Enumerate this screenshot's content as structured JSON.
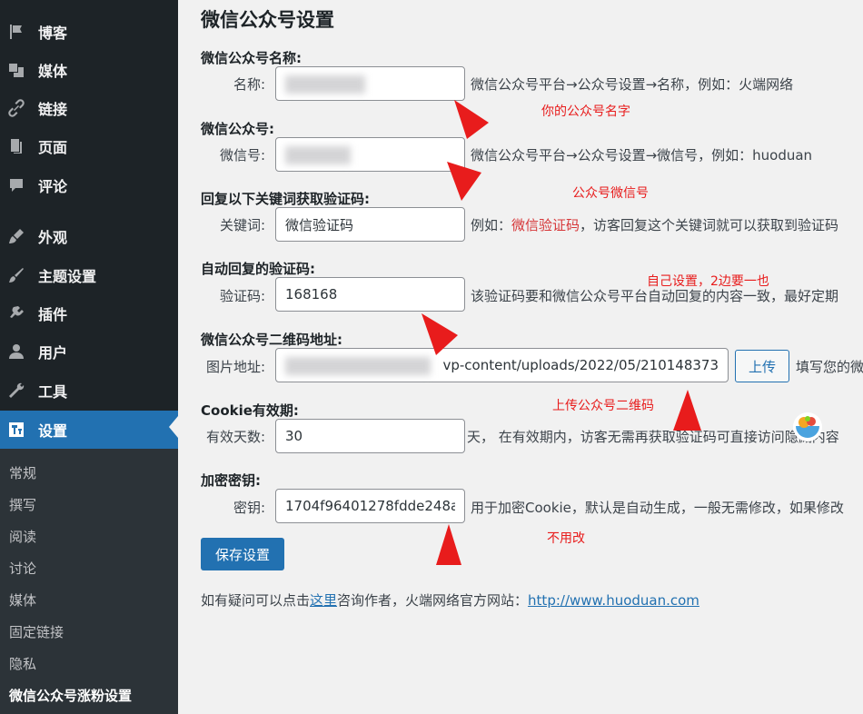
{
  "sidebar": {
    "items": [
      {
        "label": "博客",
        "icon": "flag-icon"
      },
      {
        "label": "媒体",
        "icon": "media-icon"
      },
      {
        "label": "链接",
        "icon": "link-icon"
      },
      {
        "label": "页面",
        "icon": "page-icon"
      },
      {
        "label": "评论",
        "icon": "comment-icon"
      },
      {
        "label": "外观",
        "icon": "paintbrush-icon"
      },
      {
        "label": "主题设置",
        "icon": "brush-icon"
      },
      {
        "label": "插件",
        "icon": "plugin-icon"
      },
      {
        "label": "用户",
        "icon": "user-icon"
      },
      {
        "label": "工具",
        "icon": "wrench-icon"
      },
      {
        "label": "设置",
        "icon": "settings-icon"
      }
    ],
    "submenu": [
      "常规",
      "撰写",
      "阅读",
      "讨论",
      "媒体",
      "固定链接",
      "隐私",
      "微信公众号涨粉设置"
    ]
  },
  "page": {
    "title": "微信公众号设置",
    "sections": [
      {
        "heading": "微信公众号名称:",
        "label": "名称:",
        "value": "",
        "desc": "微信公众号平台→公众号设置→名称，例如：火端网络"
      },
      {
        "heading": "微信公众号:",
        "label": "微信号:",
        "value": "",
        "desc": "微信公众号平台→公众号设置→微信号，例如：huoduan"
      },
      {
        "heading": "回复以下关键词获取验证码:",
        "label": "关键词:",
        "value": "微信验证码",
        "desc_prefix": "例如：",
        "desc_highlight": "微信验证码",
        "desc_suffix": "，访客回复这个关键词就可以获取到验证码"
      },
      {
        "heading": "自动回复的验证码:",
        "label": "验证码:",
        "value": "168168",
        "desc": "该验证码要和微信公众号平台自动回复的内容一致，最好定期"
      },
      {
        "heading": "微信公众号二维码地址:",
        "label": "图片地址:",
        "value": "vp-content/uploads/2022/05/210148373",
        "upload_label": "上传",
        "desc": "填写您的微"
      },
      {
        "heading": "Cookie有效期:",
        "label": "有效天数:",
        "value": "30",
        "desc": "天，  在有效期内，访客无需再获取验证码可直接访问隐藏内容"
      },
      {
        "heading": "加密密钥:",
        "label": "密钥:",
        "value": "1704f96401278fdde248a",
        "desc": "用于加密Cookie，默认是自动生成，一般无需修改，如果修改"
      }
    ],
    "save_label": "保存设置",
    "footer": {
      "prefix": "如有疑问可以点击",
      "link_text": "这里",
      "middle": "咨询作者，火端网络官方网站：",
      "site_url": "http://www.huoduan.com"
    }
  },
  "annotations": {
    "name_note": "你的公众号名字",
    "wechat_note": "公众号微信号",
    "code_note": "自己设置，2边要一也",
    "qr_note": "上传公众号二维码",
    "key_note": "不用改"
  },
  "colors": {
    "sidebar_bg": "#1d2327",
    "submenu_bg": "#2c3338",
    "accent": "#2271b1",
    "annotation_red": "#e81c1c"
  }
}
